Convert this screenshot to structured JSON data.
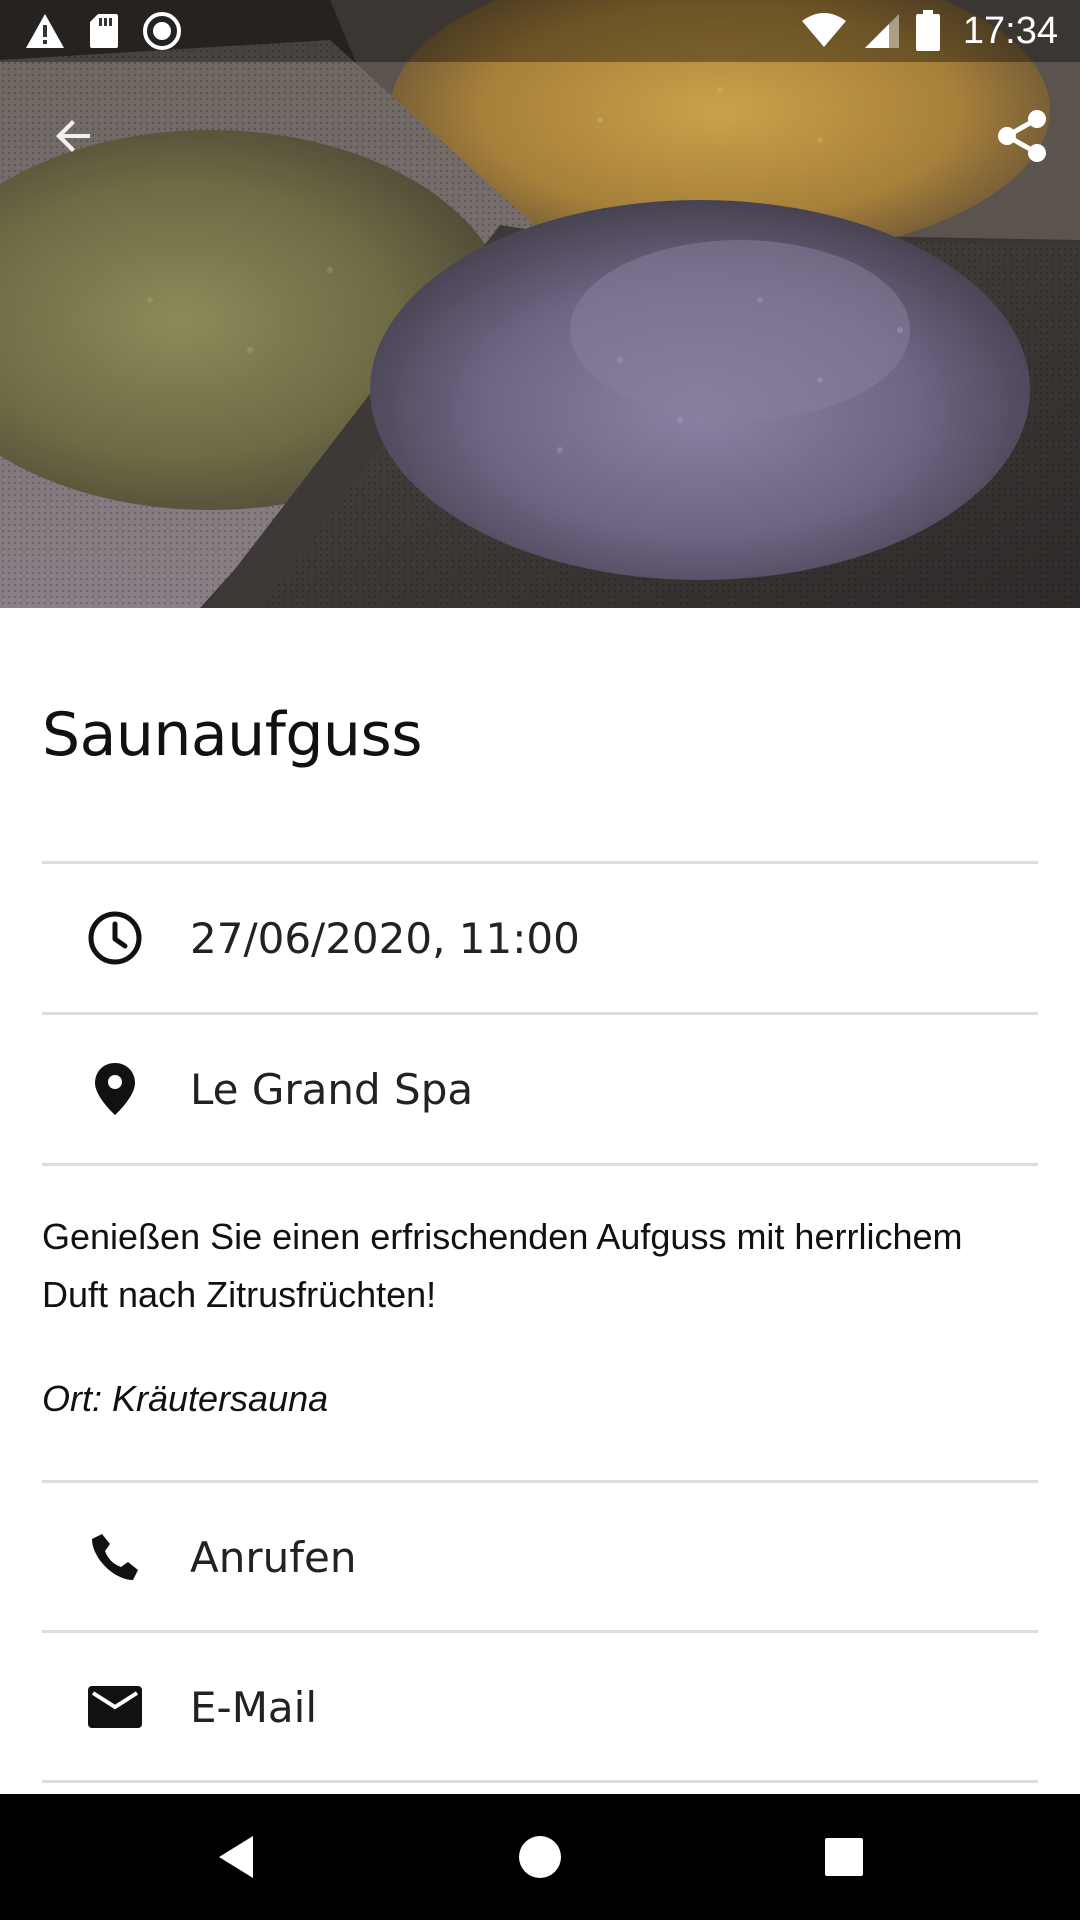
{
  "status_bar": {
    "time": "17:34",
    "icons": [
      "warning-icon",
      "sd-card-icon",
      "record-icon",
      "wifi-icon",
      "signal-icon",
      "battery-icon"
    ]
  },
  "app_bar": {
    "back_icon": "arrow-back-icon",
    "share_icon": "share-icon"
  },
  "event": {
    "title": "Saunaufguss",
    "datetime": "27/06/2020, 11:00",
    "location": "Le Grand Spa",
    "description": "Genießen Sie einen erfrischenden Aufguss mit herrlichem Duft nach Zitrusfrüchten!",
    "location_note": "Ort: Kräutersauna"
  },
  "actions": {
    "call_label": "Anrufen",
    "email_label": "E-Mail"
  },
  "nav_bar": {
    "icons": [
      "nav-back-icon",
      "nav-home-icon",
      "nav-recents-icon"
    ]
  },
  "colors": {
    "text": "#111111",
    "divider": "#dcdcdc",
    "nav_bar": "#000000"
  }
}
